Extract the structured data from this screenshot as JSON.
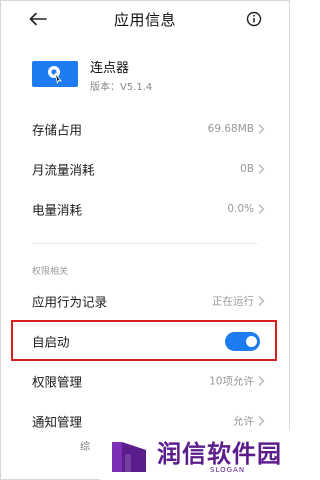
{
  "header": {
    "title": "应用信息",
    "back_icon": "back-arrow-icon",
    "info_icon": "info-circle-icon"
  },
  "app": {
    "name": "连点器",
    "version": "版本：V5.1.4",
    "icon": "tap-cursor-icon",
    "icon_color": "#1d7cf2"
  },
  "rows": [
    {
      "label": "存储占用",
      "value": "69.68MB"
    },
    {
      "label": "月流量消耗",
      "value": "0B"
    },
    {
      "label": "电量消耗",
      "value": "0.0%"
    }
  ],
  "permissions": {
    "section_title": "权限相关",
    "behavior": {
      "label": "应用行为记录",
      "value": "正在运行"
    },
    "autostart": {
      "label": "自启动",
      "enabled": true
    },
    "manage": {
      "label": "权限管理",
      "value": "10项允许"
    },
    "notify": {
      "label": "通知管理",
      "value": "允许"
    }
  },
  "partial_text": "综",
  "colors": {
    "accent": "#1d7cf2",
    "highlight_border": "#d31f1f",
    "watermark": "#5c1d8c"
  },
  "watermark": {
    "text": "润信软件园",
    "slogan": "SLOGAN"
  }
}
